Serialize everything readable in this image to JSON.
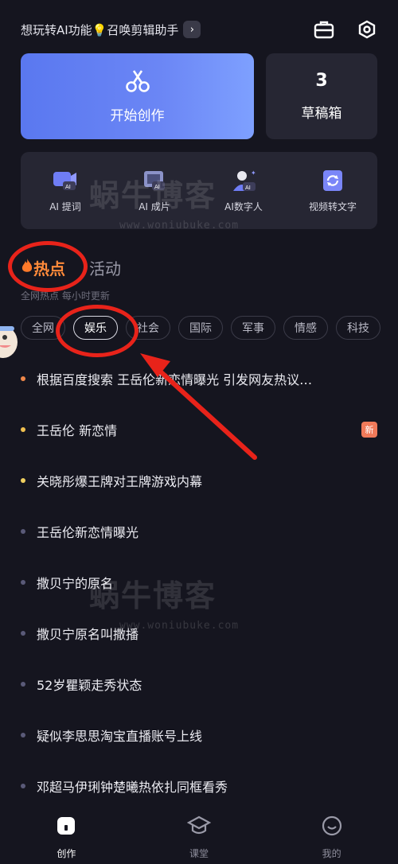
{
  "topbar": {
    "promo_text": "想玩转AI功能💡召唤剪辑助手",
    "promo_arrow": "›",
    "icons": [
      "toolbox-icon",
      "settings-icon"
    ]
  },
  "create": {
    "label": "开始创作",
    "icon": "scissors-icon"
  },
  "drafts": {
    "count": "3",
    "label": "草稿箱"
  },
  "tools": [
    {
      "label": "AI 提词",
      "icon": "ai-prompt-icon"
    },
    {
      "label": "AI 成片",
      "icon": "ai-film-icon"
    },
    {
      "label": "AI数字人",
      "icon": "ai-avatar-icon"
    },
    {
      "label": "视频转文字",
      "icon": "video-to-text-icon"
    }
  ],
  "sections": {
    "hot": "热点",
    "activity": "活动",
    "note": "全网热点 每小时更新"
  },
  "categories": [
    {
      "label": "全网",
      "active": false
    },
    {
      "label": "娱乐",
      "active": true
    },
    {
      "label": "社会",
      "active": false
    },
    {
      "label": "国际",
      "active": false
    },
    {
      "label": "军事",
      "active": false
    },
    {
      "label": "情感",
      "active": false
    },
    {
      "label": "科技",
      "active": false
    }
  ],
  "feed": [
    {
      "text": "根据百度搜索 王岳伦新恋情曝光 引发网友热议…",
      "dot_color": "#f0884a"
    },
    {
      "text": "王岳伦 新恋情",
      "dot_color": "#f0c050",
      "badge": "新"
    },
    {
      "text": "关晓彤爆王牌对王牌游戏内幕",
      "dot_color": "#f0d060"
    },
    {
      "text": "王岳伦新恋情曝光",
      "dot_color": "#5a5a78"
    },
    {
      "text": "撒贝宁的原名",
      "dot_color": "#5a5a78"
    },
    {
      "text": "撒贝宁原名叫撒播",
      "dot_color": "#5a5a78"
    },
    {
      "text": "52岁瞿颖走秀状态",
      "dot_color": "#5a5a78"
    },
    {
      "text": "疑似李思思淘宝直播账号上线",
      "dot_color": "#5a5a78"
    },
    {
      "text": "邓超马伊琍钟楚曦热依扎同框看秀",
      "dot_color": "#5a5a78"
    }
  ],
  "tabbar": [
    {
      "label": "创作",
      "icon": "home-icon",
      "active": true
    },
    {
      "label": "课堂",
      "icon": "graduation-cap-icon",
      "active": false
    },
    {
      "label": "我的",
      "icon": "profile-icon",
      "active": false
    }
  ],
  "watermark": {
    "text": "蜗牛博客",
    "url": "www.woniubuke.com"
  },
  "colors": {
    "accent_blue": "#5a78f0",
    "hot_orange": "#ff8a3a",
    "annotation_red": "#e8231a",
    "background": "#15151f",
    "card": "#262633"
  }
}
